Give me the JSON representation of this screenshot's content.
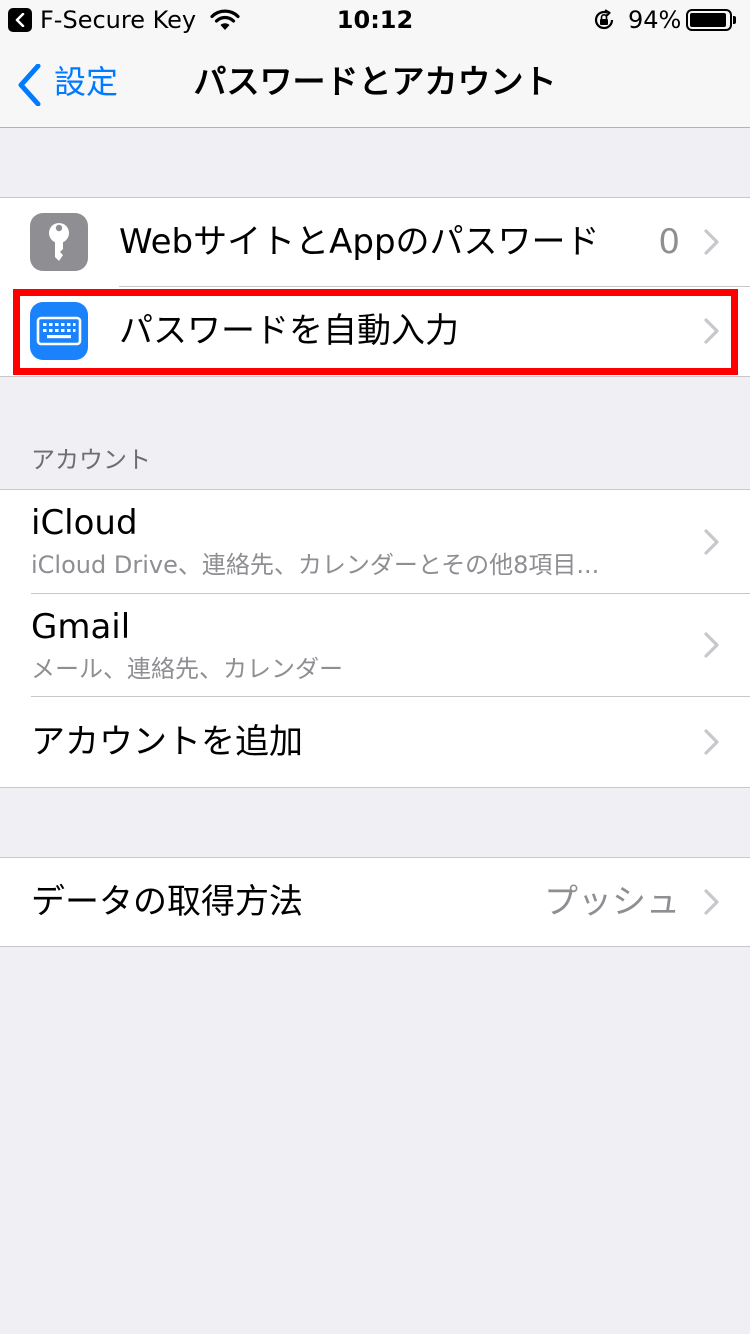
{
  "status_bar": {
    "app_name": "F-Secure Key",
    "time": "10:12",
    "battery_percent": "94%",
    "battery_level": 0.94
  },
  "nav": {
    "back_label": "設定",
    "title": "パスワードとアカウント"
  },
  "passwords_group": {
    "items": [
      {
        "label": "WebサイトとAppのパスワード",
        "value": "0",
        "icon": "key-icon",
        "icon_color": "#8e8e93"
      },
      {
        "label": "パスワードを自動入力",
        "icon": "keyboard-icon",
        "icon_color": "#1a82fb",
        "highlighted": true
      }
    ]
  },
  "accounts_section": {
    "header": "アカウント",
    "items": [
      {
        "title": "iCloud",
        "subtitle": "iCloud Drive、連絡先、カレンダーとその他8項目..."
      },
      {
        "title": "Gmail",
        "subtitle": "メール、連絡先、カレンダー"
      },
      {
        "title": "アカウントを追加"
      }
    ]
  },
  "fetch_group": {
    "label": "データの取得方法",
    "value": "プッシュ"
  },
  "colors": {
    "accent": "#007aff",
    "highlight": "#ff0000",
    "background": "#efeff4"
  }
}
